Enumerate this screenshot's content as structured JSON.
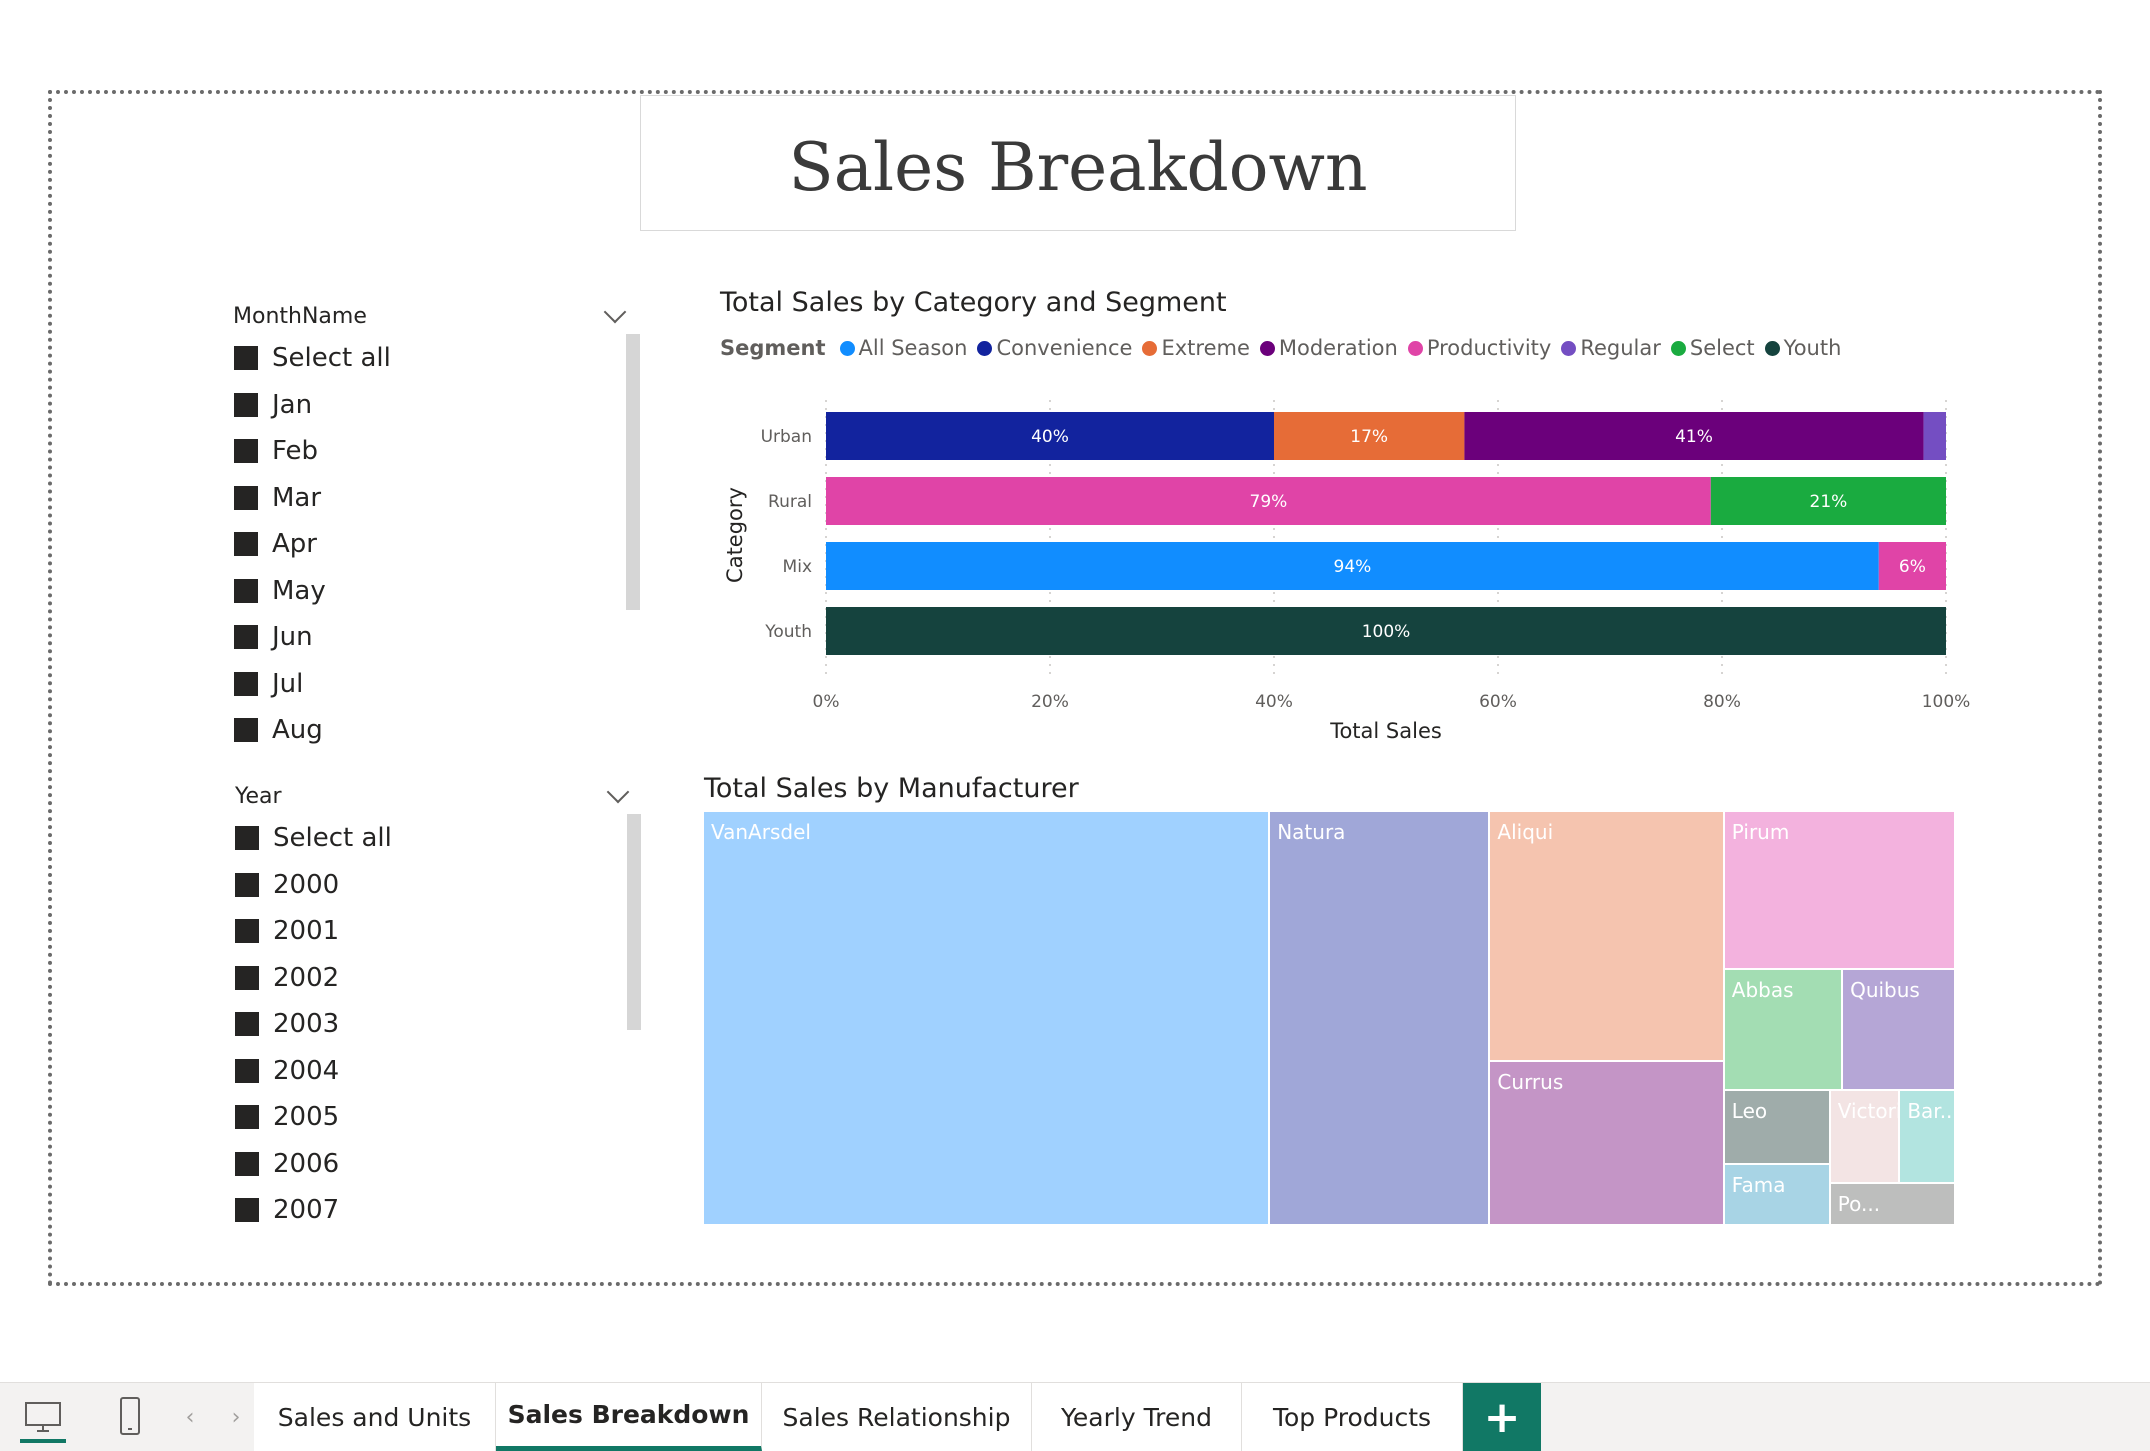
{
  "report": {
    "title": "Sales Breakdown"
  },
  "slicers": {
    "month": {
      "header": "MonthName",
      "items": [
        "Select all",
        "Jan",
        "Feb",
        "Mar",
        "Apr",
        "May",
        "Jun",
        "Jul",
        "Aug"
      ]
    },
    "year": {
      "header": "Year",
      "items": [
        "Select all",
        "2000",
        "2001",
        "2002",
        "2003",
        "2004",
        "2005",
        "2006",
        "2007"
      ]
    }
  },
  "chart_data": [
    {
      "type": "bar",
      "title": "Total Sales by Category and Segment",
      "xlabel": "Total Sales",
      "ylabel": "Category",
      "legend_title": "Segment",
      "legend_position": "top-left",
      "stacked": "100%",
      "categories": [
        "Urban",
        "Rural",
        "Mix",
        "Youth"
      ],
      "xlim": [
        0,
        100
      ],
      "x_ticks": [
        "0%",
        "20%",
        "40%",
        "60%",
        "80%",
        "100%"
      ],
      "grid": true,
      "series": [
        {
          "name": "All Season",
          "color": "#118DFF",
          "values": [
            0,
            0,
            94,
            0
          ],
          "labels": [
            "",
            "",
            "94%",
            ""
          ]
        },
        {
          "name": "Convenience",
          "color": "#12239E",
          "values": [
            40,
            0,
            0,
            0
          ],
          "labels": [
            "40%",
            "",
            "",
            ""
          ]
        },
        {
          "name": "Extreme",
          "color": "#E66C37",
          "values": [
            17,
            0,
            0,
            0
          ],
          "labels": [
            "17%",
            "",
            "",
            ""
          ]
        },
        {
          "name": "Moderation",
          "color": "#6B007B",
          "values": [
            41,
            0,
            0,
            0
          ],
          "labels": [
            "41%",
            "",
            "",
            ""
          ]
        },
        {
          "name": "Productivity",
          "color": "#E044A7",
          "values": [
            0,
            79,
            6,
            0
          ],
          "labels": [
            "",
            "79%",
            "6%",
            ""
          ]
        },
        {
          "name": "Regular",
          "color": "#744EC2",
          "values": [
            2,
            0,
            0,
            0
          ],
          "labels": [
            "",
            "",
            "",
            ""
          ]
        },
        {
          "name": "Select",
          "color": "#1AAB40",
          "values": [
            0,
            21,
            0,
            0
          ],
          "labels": [
            "",
            "21%",
            "",
            ""
          ]
        },
        {
          "name": "Youth",
          "color": "#15433E",
          "values": [
            0,
            0,
            0,
            100
          ],
          "labels": [
            "",
            "",
            "",
            "100%"
          ]
        }
      ]
    },
    {
      "type": "treemap",
      "title": "Total Sales by Manufacturer",
      "items": [
        {
          "name": "VanArsdel",
          "label": "VanArsdel",
          "value": 36.0,
          "color": "#A0D1FF"
        },
        {
          "name": "Natura",
          "label": "Natura",
          "value": 14.0,
          "color": "#A0A7D8"
        },
        {
          "name": "Aliqui",
          "label": "Aliqui",
          "value": 9.0,
          "color": "#F5C4AF"
        },
        {
          "name": "Currus",
          "label": "Currus",
          "value": 5.9,
          "color": "#C495C6"
        },
        {
          "name": "Pirum",
          "label": "Pirum",
          "value": 5.6,
          "color": "#F3B2DE"
        },
        {
          "name": "Quibus",
          "label": "Quibus",
          "value": 2.1,
          "color": "#B5A6D6"
        },
        {
          "name": "Abbas",
          "label": "Abbas",
          "value": 2.2,
          "color": "#A3DDB3"
        },
        {
          "name": "Leo",
          "label": "Leo",
          "value": 1.2,
          "color": "#9FACAA"
        },
        {
          "name": "Fama",
          "label": "Fama",
          "value": 1.0,
          "color": "#A8D4E5"
        },
        {
          "name": "Victoria",
          "label": "Victoria",
          "value": 1.0,
          "color": "#F3E4E4"
        },
        {
          "name": "Barba",
          "label": "Bar...",
          "value": 0.8,
          "color": "#B2E4E0"
        },
        {
          "name": "Pomum",
          "label": "Po...",
          "value": 0.8,
          "color": "#BDBEBD"
        }
      ]
    }
  ],
  "tabs": {
    "items": [
      {
        "label": "Sales and Units",
        "active": false
      },
      {
        "label": "Sales Breakdown",
        "active": true
      },
      {
        "label": "Sales Relationship",
        "active": false
      },
      {
        "label": "Yearly Trend",
        "active": false
      },
      {
        "label": "Top Products",
        "active": false
      }
    ],
    "add_label": "+"
  },
  "icons": {
    "desktop": "desktop-view-icon",
    "mobile": "mobile-view-icon",
    "prev": "chevron-left-icon",
    "next": "chevron-right-icon"
  },
  "colors": {
    "accent": "#117865"
  }
}
